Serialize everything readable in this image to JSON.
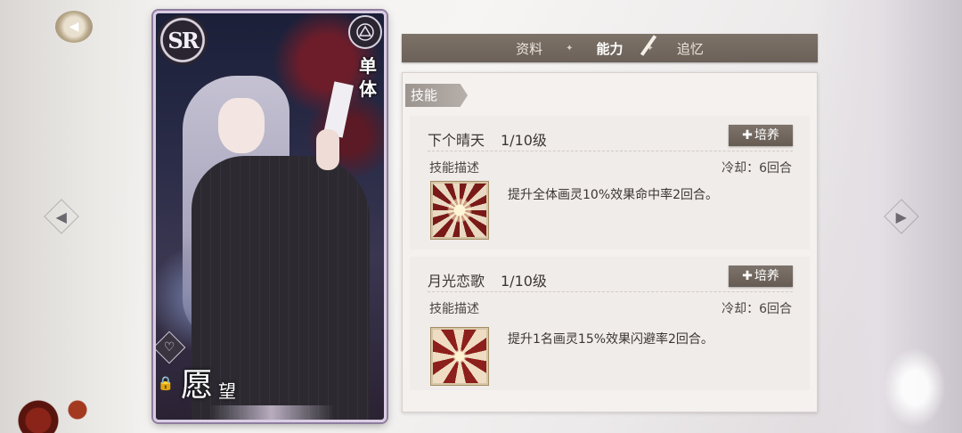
{
  "card": {
    "rarity": "SR",
    "target": "单体",
    "name_main": "愿",
    "name_sub": "望"
  },
  "tabs": [
    {
      "label": "资料",
      "active": false
    },
    {
      "label": "能力",
      "active": true
    },
    {
      "label": "追忆",
      "active": false
    }
  ],
  "panel": {
    "section_label": "技能",
    "skills": [
      {
        "name": "下个晴天",
        "level": "1/10级",
        "train_label": "培养",
        "desc_label": "技能描述",
        "cooldown": "冷却：6回合",
        "description": "提升全体画灵10%效果命中率2回合。",
        "icon": "sunburst-skill-icon"
      },
      {
        "name": "月光恋歌",
        "level": "1/10级",
        "train_label": "培养",
        "desc_label": "技能描述",
        "cooldown": "冷却：6回合",
        "description": "提升1名画灵15%效果闪避率2回合。",
        "icon": "swirl-skill-icon"
      }
    ]
  },
  "colors": {
    "tab_bar": "#6b6158",
    "train_button": "#655c54",
    "panel_bg": "#f4f1ef",
    "card_border": "#8f7ca0"
  }
}
